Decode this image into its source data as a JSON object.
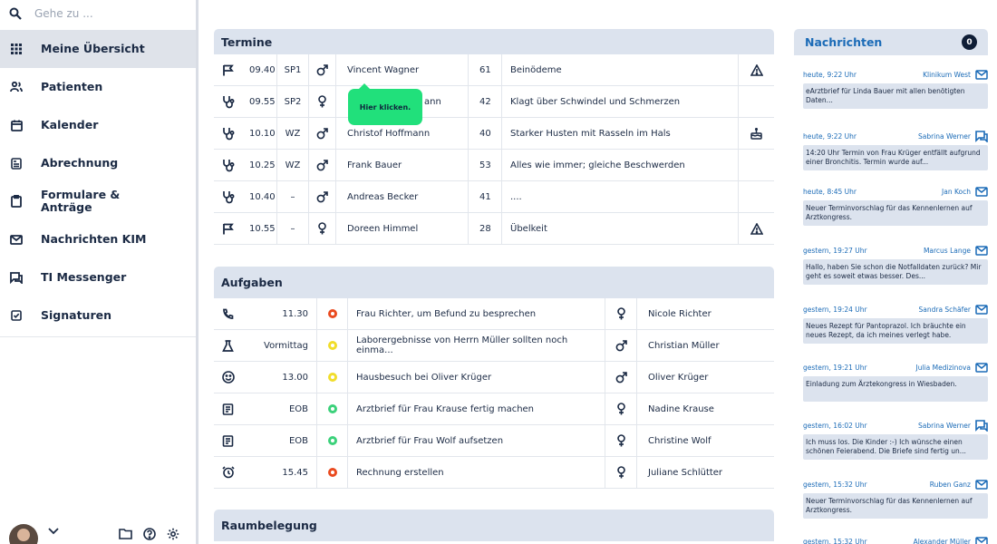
{
  "search": {
    "placeholder": "Gehe zu ..."
  },
  "sidebar": {
    "items": [
      {
        "label": "Meine Übersicht",
        "icon": "grid-icon",
        "active": true
      },
      {
        "label": "Patienten",
        "icon": "users-icon"
      },
      {
        "label": "Kalender",
        "icon": "calendar-icon"
      },
      {
        "label": "Abrechnung",
        "icon": "billing-icon"
      },
      {
        "label": "Formulare & Anträge",
        "icon": "clipboard-icon"
      },
      {
        "label": "Nachrichten KIM",
        "icon": "mail-icon"
      },
      {
        "label": "TI Messenger",
        "icon": "chat-icon"
      },
      {
        "label": "Signaturen",
        "icon": "checkbox-icon"
      }
    ]
  },
  "termine": {
    "title": "Termine",
    "rows": [
      {
        "icon": "flag-icon",
        "time": "09.40",
        "room": "SP1",
        "gender": "male",
        "name": "Vincent Wagner",
        "age": "61",
        "reason": "Beinödeme",
        "flag": "warning-icon"
      },
      {
        "icon": "stethoscope-icon",
        "time": "09.55",
        "room": "SP2",
        "gender": "female",
        "name": "ann",
        "age": "42",
        "reason": "Klagt über Schwindel und Schmerzen",
        "flag": ""
      },
      {
        "icon": "stethoscope-icon",
        "time": "10.10",
        "room": "WZ",
        "gender": "male",
        "name": "Christof Hoffmann",
        "age": "40",
        "reason": "Starker Husten mit Rasseln im Hals",
        "flag": "cake-icon"
      },
      {
        "icon": "stethoscope-icon",
        "time": "10.25",
        "room": "WZ",
        "gender": "male",
        "name": "Frank Bauer",
        "age": "53",
        "reason": "Alles wie immer; gleiche Beschwerden",
        "flag": ""
      },
      {
        "icon": "stethoscope-icon",
        "time": "10.40",
        "room": "–",
        "gender": "male",
        "name": "Andreas Becker",
        "age": "41",
        "reason": "....",
        "flag": ""
      },
      {
        "icon": "flag-icon",
        "time": "10.55",
        "room": "–",
        "gender": "female",
        "name": "Doreen Himmel",
        "age": "28",
        "reason": "Übelkeit",
        "flag": "warning-icon"
      }
    ]
  },
  "tooltip": {
    "text": "Hier klicken."
  },
  "aufgaben": {
    "title": "Aufgaben",
    "rows": [
      {
        "icon": "phone-icon",
        "when": "11.30",
        "status": "red",
        "task": "Frau Richter, um Befund zu besprechen",
        "gender": "female",
        "person": "Nicole Richter"
      },
      {
        "icon": "lab-icon",
        "when": "Vormittag",
        "status": "yellow",
        "task": "Laborergebnisse von Herrn Müller sollten noch einma...",
        "gender": "male",
        "person": "Christian Müller"
      },
      {
        "icon": "smiley-icon",
        "when": "13.00",
        "status": "yellow",
        "task": "Hausbesuch bei Oliver Krüger",
        "gender": "male",
        "person": "Oliver Krüger"
      },
      {
        "icon": "document-icon",
        "when": "EOB",
        "status": "green",
        "task": "Arztbrief für Frau Krause fertig machen",
        "gender": "female",
        "person": "Nadine Krause"
      },
      {
        "icon": "document-icon",
        "when": "EOB",
        "status": "green",
        "task": "Arztbrief für Frau Wolf aufsetzen",
        "gender": "female",
        "person": "Christine Wolf"
      },
      {
        "icon": "alarm-icon",
        "when": "15.45",
        "status": "red",
        "task": "Rechnung erstellen",
        "gender": "female",
        "person": "Juliane Schlütter"
      }
    ]
  },
  "raum": {
    "title": "Raumbelegung"
  },
  "nachrichten": {
    "title": "Nachrichten",
    "count": "0",
    "items": [
      {
        "time": "heute, 9:22 Uhr",
        "from": "Klinikum West",
        "type": "mail",
        "text": "eArztbrief für Linda Bauer mit allen benötigten Daten..."
      },
      {
        "time": "heute, 9:22 Uhr",
        "from": "Sabrina Werner",
        "type": "chat",
        "text": "14:20 Uhr Termin von Frau Krüger entfällt aufgrund einer Bronchitis. Termin wurde auf..."
      },
      {
        "time": "heute, 8:45 Uhr",
        "from": "Jan Koch",
        "type": "mail",
        "text": "Neuer Terminvorschlag für das Kennenlernen auf Arztkongress."
      },
      {
        "time": "gestern, 19:27 Uhr",
        "from": "Marcus Lange",
        "type": "mail",
        "text": "Hallo, haben Sie schon die Notfalldaten zurück? Mir geht es soweit etwas besser. Des..."
      },
      {
        "time": "gestern, 19:24 Uhr",
        "from": "Sandra Schäfer",
        "type": "mail",
        "text": "Neues Rezept für Pantoprazol. Ich bräuchte ein neues Rezept, da ich meines verlegt habe."
      },
      {
        "time": "gestern, 19:21 Uhr",
        "from": "Julia Medizinova",
        "type": "mail",
        "text": "Einladung zum Ärztekongress in Wiesbaden."
      },
      {
        "time": "gestern, 16:02 Uhr",
        "from": "Sabrina Werner",
        "type": "chat",
        "text": "Ich muss los. Die Kinder :-) Ich wünsche einen schönen Feierabend. Die Briefe sind fertig un..."
      },
      {
        "time": "gestern, 15:32 Uhr",
        "from": "Ruben Ganz",
        "type": "mail",
        "text": "Neuer Terminvorschlag für das Kennenlernen auf Arztkongress."
      },
      {
        "time": "gestern, 15:32 Uhr",
        "from": "Alexander Müller",
        "type": "mail",
        "text": ""
      }
    ]
  },
  "colors": {
    "red": "#ea4a1f",
    "yellow": "#f1dd2a",
    "green": "#3bd17a",
    "accent": "#1b6bb7",
    "header": "#dce3ee"
  }
}
